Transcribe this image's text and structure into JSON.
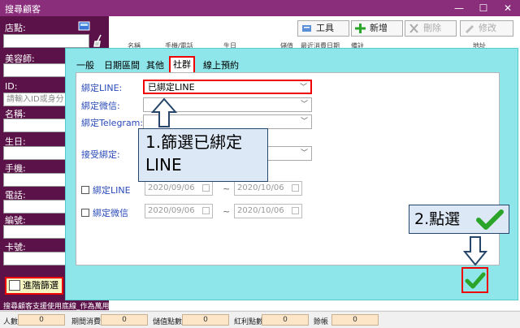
{
  "window": {
    "title": "搜尋顧客",
    "minimize": "—",
    "maximize": "☐",
    "close": "✕"
  },
  "sidebar": {
    "store_label": "店點:",
    "beautician_label": "美容師:",
    "id_label": "ID:",
    "id_placeholder": "請輸入ID或身分",
    "name_label": "名稱:",
    "birthday_label": "生日:",
    "mobile_label": "手機:",
    "phone_label": "電話:",
    "number_label": "編號:",
    "card_label": "卡號:",
    "advanced_filter": "進階篩選",
    "note": "搜尋顧客支援使用底線_作為萬用字元"
  },
  "toolbar": {
    "tools": "工具",
    "add": "新增",
    "delete": "刪除",
    "edit": "修改"
  },
  "table": {
    "headers": [
      "名稱",
      "手機/電話",
      "生日",
      "儲值",
      "最近消費日期",
      "備註",
      "地址"
    ]
  },
  "dialog": {
    "tabs": [
      "一般",
      "日期區間",
      "其他",
      "社群",
      "線上預約"
    ],
    "active_tab": "社群",
    "fields": {
      "line_label": "綁定LINE:",
      "line_value": "已綁定LINE",
      "wechat_label": "綁定微信:",
      "telegram_label": "綁定Telegram:",
      "accept_label": "接受綁定:"
    },
    "date_rows": [
      {
        "label": "綁定LINE",
        "from": "2020/09/06",
        "to": "2020/10/06"
      },
      {
        "label": "綁定微信",
        "from": "2020/09/06",
        "to": "2020/10/06"
      }
    ],
    "tilde": "~"
  },
  "annotations": {
    "step1_line1": "1.篩選已綁定",
    "step1_line2": "LINE",
    "step2": "2.點選"
  },
  "statusbar": {
    "people_label": "人數",
    "people_value": "0",
    "period_label": "期間消費金額",
    "period_value": "0",
    "stored_label": "儲值點數",
    "stored_value": "0",
    "bonus_label": "紅利點數",
    "bonus_value": "0",
    "account_label": "賒帳",
    "account_value": "0"
  },
  "colors": {
    "title_bar": "#8a2e7c",
    "sidebar": "#5a1248",
    "dialog": "#8fe6ea",
    "highlight": "#ee0000",
    "check_green": "#2aa52a"
  }
}
